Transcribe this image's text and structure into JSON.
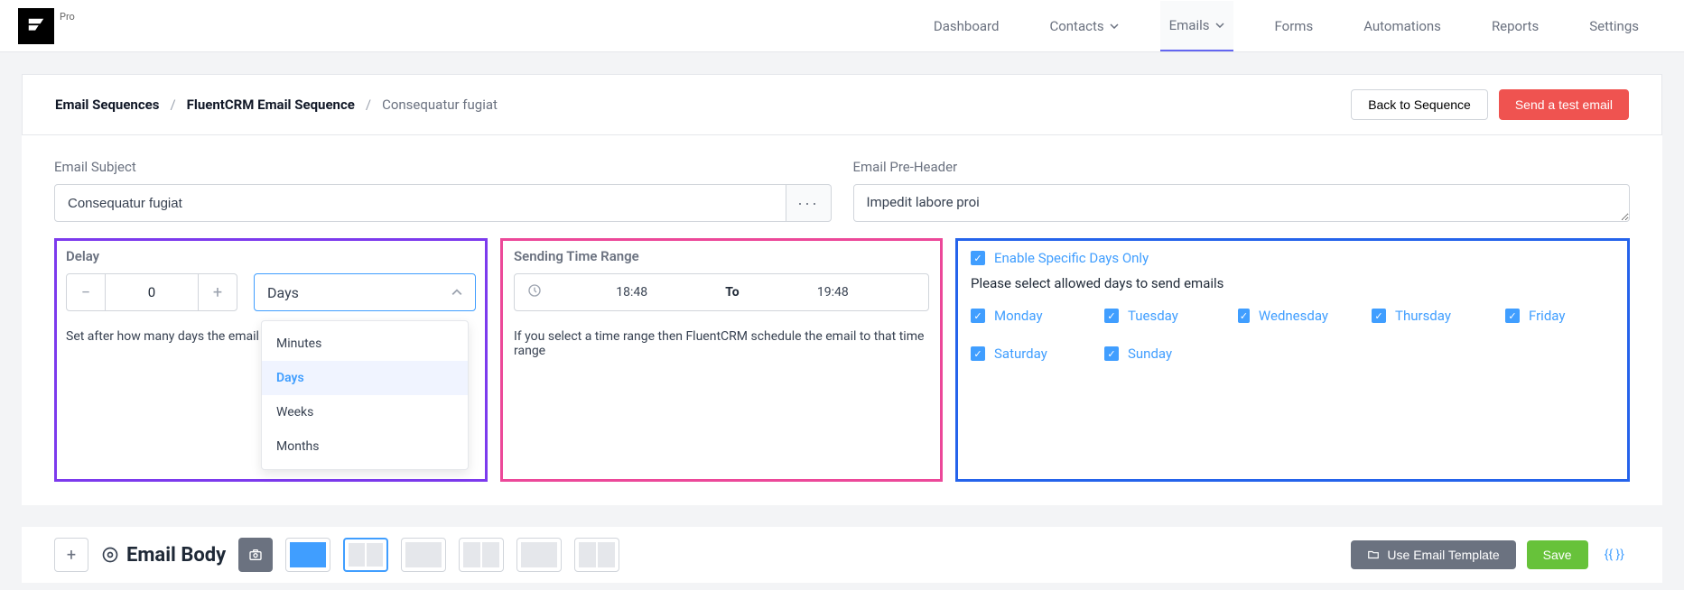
{
  "header": {
    "pro_label": "Pro",
    "nav": {
      "dashboard": "Dashboard",
      "contacts": "Contacts",
      "emails": "Emails",
      "forms": "Forms",
      "automations": "Automations",
      "reports": "Reports",
      "settings": "Settings"
    }
  },
  "breadcrumb": {
    "root": "Email Sequences",
    "parent": "FluentCRM Email Sequence",
    "current": "Consequatur fugiat"
  },
  "actions": {
    "back": "Back to Sequence",
    "send_test": "Send a test email"
  },
  "form": {
    "subject_label": "Email Subject",
    "subject_value": "Consequatur fugiat",
    "preheader_label": "Email Pre-Header",
    "preheader_value": "Impedit labore proi"
  },
  "delay": {
    "title": "Delay",
    "value": "0",
    "unit": "Days",
    "help": "Set after how many days the email",
    "options": {
      "minutes": "Minutes",
      "days": "Days",
      "weeks": "Weeks",
      "months": "Months"
    }
  },
  "time_range": {
    "title": "Sending Time Range",
    "start": "18:48",
    "sep": "To",
    "end": "19:48",
    "help": "If you select a time range then FluentCRM schedule the email to that time range"
  },
  "days": {
    "enable_label": "Enable Specific Days Only",
    "desc": "Please select allowed days to send emails",
    "monday": "Monday",
    "tuesday": "Tuesday",
    "wednesday": "Wednesday",
    "thursday": "Thursday",
    "friday": "Friday",
    "saturday": "Saturday",
    "sunday": "Sunday"
  },
  "bottom": {
    "body_title": "Email Body",
    "use_template": "Use Email Template",
    "save": "Save",
    "code": "{{ }}"
  }
}
